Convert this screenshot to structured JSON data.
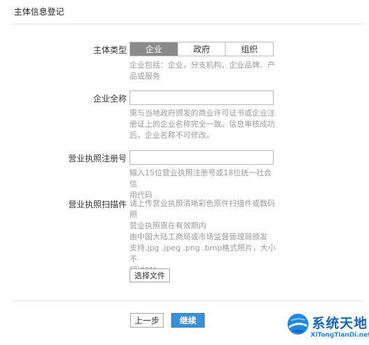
{
  "header": {
    "title": "主体信息登记"
  },
  "entity_type": {
    "label": "主体类型",
    "options": [
      "企业",
      "政府",
      "组织"
    ],
    "selected": "企业",
    "hint_lines": [
      "企业包括：企业，分支机构，企业品牌、产",
      "品或服务"
    ]
  },
  "company_name": {
    "label": "企业全称",
    "value": "",
    "hint_lines": [
      "需与当地政府颁发的商业许可证书或企业注",
      "册证上的企业名称完全一致。信息审核成功",
      "后，企业名称不可修改。"
    ]
  },
  "license_no": {
    "label": "营业执照注册号",
    "value": "",
    "hint_lines": [
      "输入15位营业执照注册号或18位统一社会信",
      "用代码"
    ]
  },
  "license_scan": {
    "label": "营业执照扫描件",
    "hint_lines": [
      "请上传营业执照清晰彩色原件扫描件或数码",
      "照",
      "营业执照需在有效期内",
      "由中国大陆工商局或市场监督管理局颁发",
      "支持.jpg .jpeg .png .bmp格式照片，大小不",
      "超过2M"
    ],
    "choose_file_label": "选择文件"
  },
  "actions": {
    "prev_label": "上一步",
    "next_label": "继续"
  },
  "watermark": {
    "title": "系统天地",
    "url": "XiTongTianDi.net"
  },
  "colors": {
    "accent": "#3b8fd6",
    "segment_active": "#8a8a8a",
    "hint_text": "#9a9a9a"
  }
}
